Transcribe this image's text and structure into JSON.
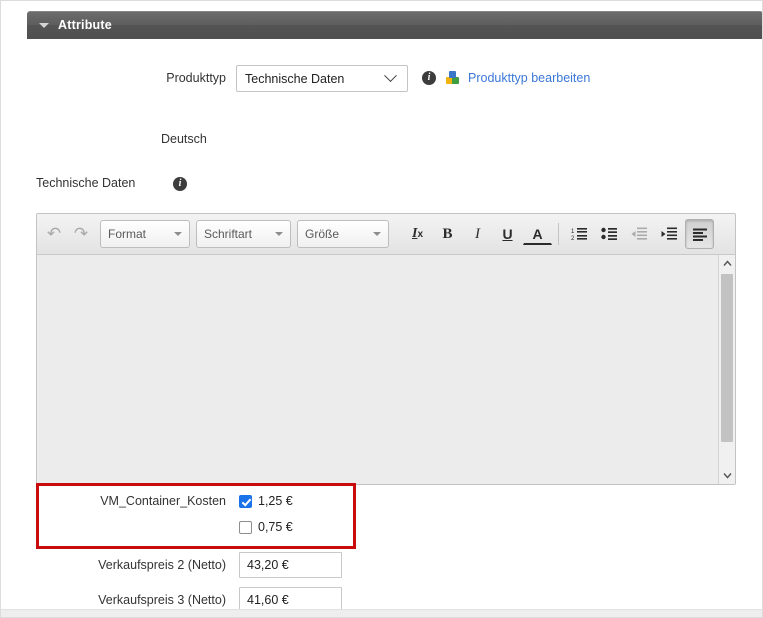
{
  "section": {
    "title": "Attribute",
    "collapse_icon": "triangle-down-icon"
  },
  "product_type": {
    "label": "Produkttyp",
    "selected_value": "Technische Daten",
    "dropdown_icon": "chevron-down-icon",
    "info_icon": "info-icon",
    "info_glyph": "i",
    "blocks_icon": "product-blocks-icon",
    "edit_link": "Produkttyp bearbeiten",
    "link_color": "#3b78d8"
  },
  "language": {
    "label": "Deutsch"
  },
  "field_group": {
    "label": "Technische Daten",
    "info_icon": "info-icon",
    "info_glyph": "i"
  },
  "editor": {
    "undo_icon": "undo-arrow-icon",
    "undo_glyph": "↶",
    "redo_icon": "redo-arrow-icon",
    "redo_glyph": "↷",
    "combos": [
      {
        "label": "Format",
        "name": "format-dropdown"
      },
      {
        "label": "Schriftart",
        "name": "font-family-dropdown"
      },
      {
        "label": "Größe",
        "name": "font-size-dropdown"
      }
    ],
    "buttons": [
      {
        "name": "remove-format-icon",
        "glyph": "Iₓ",
        "state": "normal"
      },
      {
        "name": "bold-icon",
        "glyph": "B",
        "state": "normal"
      },
      {
        "name": "italic-icon",
        "glyph": "I",
        "state": "normal"
      },
      {
        "name": "underline-icon",
        "glyph": "U",
        "state": "normal"
      },
      {
        "name": "text-color-icon",
        "glyph": "A",
        "state": "normal"
      },
      {
        "name": "numbered-list-icon",
        "glyph": "",
        "state": "normal"
      },
      {
        "name": "bulleted-list-icon",
        "glyph": "",
        "state": "normal"
      },
      {
        "name": "decrease-indent-icon",
        "glyph": "",
        "state": "disabled"
      },
      {
        "name": "increase-indent-icon",
        "glyph": "",
        "state": "normal"
      },
      {
        "name": "align-icon",
        "glyph": "",
        "state": "pressed"
      }
    ],
    "content": "",
    "scroll_up_glyph": "⌃",
    "scroll_down_glyph": "⌄",
    "background_color": "#ececec"
  },
  "highlight": {
    "border_color": "#c80c0c",
    "attribute_label": "VM_Container_Kosten",
    "options": [
      {
        "label": "1,25 €",
        "checked": true
      },
      {
        "label": "0,75 €",
        "checked": false
      }
    ],
    "checked_color": "#1a73e8"
  },
  "prices": [
    {
      "label": "Verkaufspreis 2 (Netto)",
      "value": "43,20 €"
    },
    {
      "label": "Verkaufspreis 3 (Netto)",
      "value": "41,60 €"
    }
  ]
}
